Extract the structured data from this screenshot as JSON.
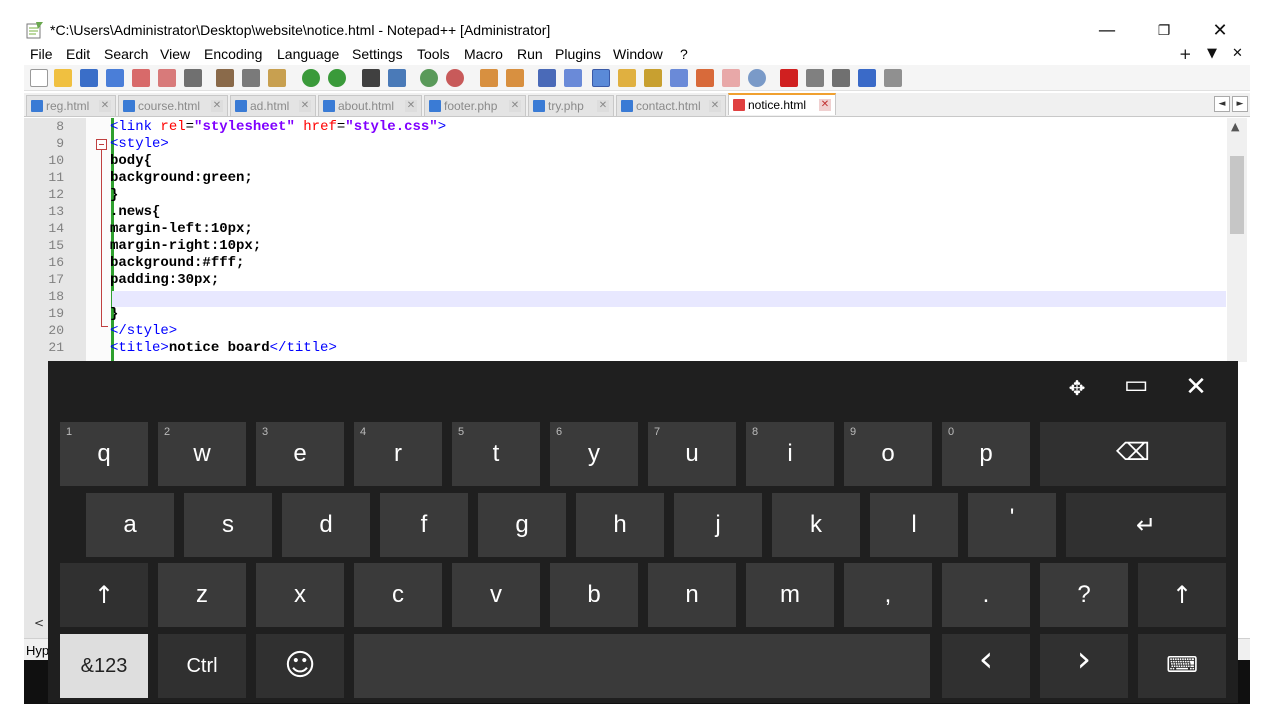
{
  "window": {
    "title": "*C:\\Users\\Administrator\\Desktop\\website\\notice.html - Notepad++ [Administrator]",
    "minimize": "—",
    "restore": "❐",
    "close": "✕"
  },
  "menu": {
    "items": [
      "File",
      "Edit",
      "Search",
      "View",
      "Encoding",
      "Language",
      "Settings",
      "Tools",
      "Macro",
      "Run",
      "Plugins",
      "Window",
      "?"
    ],
    "right": [
      "+",
      "▼",
      "✕"
    ]
  },
  "tabs": [
    {
      "label": "reg.html",
      "close": "✕"
    },
    {
      "label": "course.html",
      "close": "✕"
    },
    {
      "label": "ad.html",
      "close": "✕"
    },
    {
      "label": "about.html",
      "close": "✕"
    },
    {
      "label": "footer.php",
      "close": "✕"
    },
    {
      "label": "try.php",
      "close": "✕"
    },
    {
      "label": "contact.html",
      "close": "✕"
    },
    {
      "label": "notice.html",
      "close": "✕",
      "active": true
    }
  ],
  "tab_scroll": {
    "left": "◄",
    "right": "►"
  },
  "editor": {
    "line_numbers": [
      "8",
      "9",
      "10",
      "11",
      "12",
      "13",
      "14",
      "15",
      "16",
      "17",
      "18",
      "19",
      "20",
      "21"
    ],
    "lines": {
      "l8": {
        "open": "<link ",
        "attr1": "rel",
        "eq1": "=",
        "val1": "\"stylesheet\"",
        "sp": " ",
        "attr2": "href",
        "eq2": "=",
        "val2": "\"style.css\"",
        "close": ">"
      },
      "l9": "<style>",
      "l10": "body{",
      "l11": "background:green;",
      "l12": "}",
      "l13": ".news{",
      "l14": "margin-left:10px;",
      "l15": "margin-right:10px;",
      "l16": "background:#fff;",
      "l17": "padding:30px;",
      "l18": "",
      "l19": "}",
      "l20": "</style>",
      "l21": {
        "open": "<title>",
        "text": "notice board",
        "close": "</title>"
      }
    },
    "scroll_up": "▲",
    "hscroll_left": "<"
  },
  "status": {
    "text": "Hyp"
  },
  "keyboard": {
    "controls": {
      "move": "✥",
      "dock": "▭",
      "close": "✕"
    },
    "row1": [
      {
        "label": "q",
        "hint": "1"
      },
      {
        "label": "w",
        "hint": "2"
      },
      {
        "label": "e",
        "hint": "3"
      },
      {
        "label": "r",
        "hint": "4"
      },
      {
        "label": "t",
        "hint": "5"
      },
      {
        "label": "y",
        "hint": "6"
      },
      {
        "label": "u",
        "hint": "7"
      },
      {
        "label": "i",
        "hint": "8"
      },
      {
        "label": "o",
        "hint": "9"
      },
      {
        "label": "p",
        "hint": "0"
      }
    ],
    "backspace": "⌫",
    "row2": [
      "a",
      "s",
      "d",
      "f",
      "g",
      "h",
      "j",
      "k",
      "l",
      "'"
    ],
    "enter": "↵",
    "shift": "↑",
    "row3": [
      "z",
      "x",
      "c",
      "v",
      "b",
      "n",
      "m",
      ",",
      ".",
      "?"
    ],
    "symbols": "&123",
    "ctrl": "Ctrl",
    "emoji": "☺",
    "space": "",
    "arrow_left": "‹",
    "arrow_right": "›",
    "keyboard_switch": "⌨"
  },
  "colors": {
    "keyboard_bg": "#1f1f1f",
    "key_bg": "#3a3a3a",
    "tag_blue": "#0000ff",
    "attr_red": "#ff0000",
    "string_purple": "#8000ff",
    "change_bar_green": "#2ea02e"
  }
}
